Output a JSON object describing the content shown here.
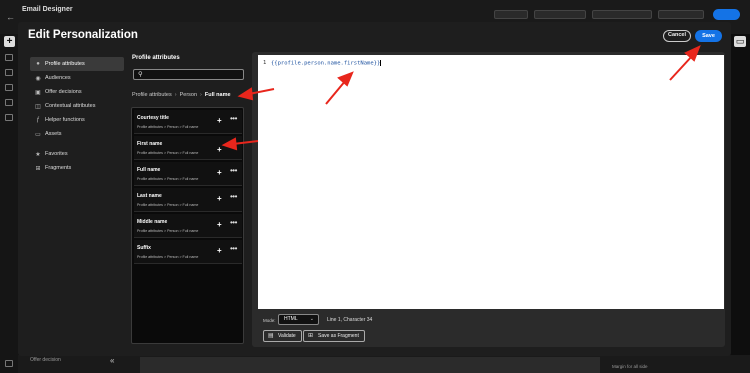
{
  "app": {
    "title": "Email Designer"
  },
  "background": {
    "offer_decision": "Offer decision",
    "margin_label": "Margin for all side"
  },
  "modal": {
    "title": "Edit Personalization",
    "cancel_label": "Cancel",
    "save_label": "Save"
  },
  "nav": {
    "items": [
      {
        "label": "Profile attributes",
        "icon": "person-icon"
      },
      {
        "label": "Audiences",
        "icon": "audience-icon"
      },
      {
        "label": "Offer decisions",
        "icon": "offer-icon"
      },
      {
        "label": "Contextual attributes",
        "icon": "context-icon"
      },
      {
        "label": "Helper functions",
        "icon": "function-icon"
      },
      {
        "label": "Assets",
        "icon": "image-icon"
      }
    ],
    "secondary": [
      {
        "label": "Favorites",
        "icon": "star-icon"
      },
      {
        "label": "Fragments",
        "icon": "fragment-icon"
      }
    ]
  },
  "attributes": {
    "heading": "Profile attributes",
    "search_placeholder": "",
    "breadcrumb": [
      "Profile attributes",
      "Person",
      "Full name"
    ],
    "items": [
      {
        "name": "Courtesy title",
        "path": "Profile attributes > Person > Full name"
      },
      {
        "name": "First name",
        "path": "Profile attributes > Person > Full name"
      },
      {
        "name": "Full name",
        "path": "Profile attributes > Person > Full name"
      },
      {
        "name": "Last name",
        "path": "Profile attributes > Person > Full name"
      },
      {
        "name": "Middle name",
        "path": "Profile attributes > Person > Full name"
      },
      {
        "name": "Suffix",
        "path": "Profile attributes > Person > Full name"
      }
    ]
  },
  "editor": {
    "line_number": "1",
    "code": "{{profile.person.name.firstName}}",
    "mode_label": "Mode:",
    "mode_value": "HTML",
    "status": "Line 1, Character 34",
    "validate_label": "Validate",
    "save_fragment_label": "Save as Fragment"
  },
  "colors": {
    "accent": "#1473e6",
    "annotation": "#e8261c"
  }
}
